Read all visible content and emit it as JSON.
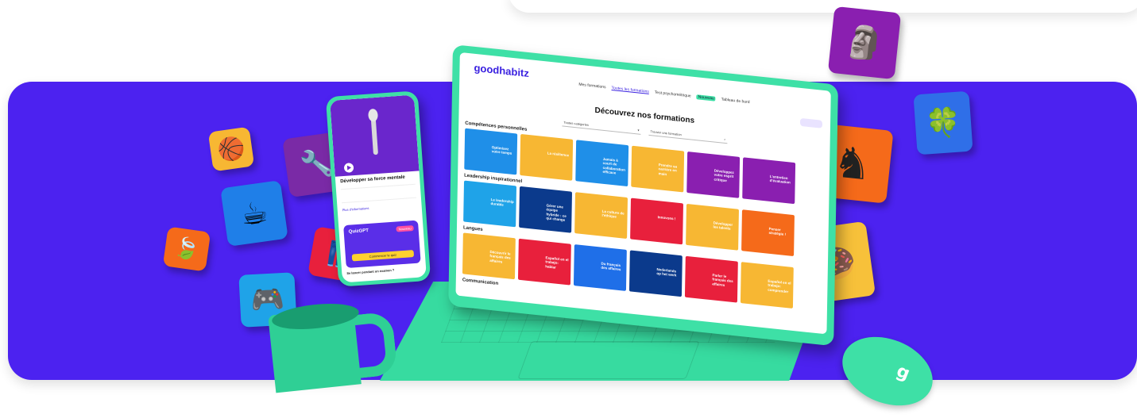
{
  "laptop": {
    "brand": "goodhabitz",
    "nav": {
      "mes_formations": "Mes formations",
      "toutes_formations": "Toutes les formations",
      "test": "Test psychométrique",
      "badge": "Nouveau",
      "tableau": "Tableau de bord"
    },
    "heading": "Découvrez nos formations",
    "filters": {
      "category": "Toutes catégories",
      "search_placeholder": "Trouver une formation"
    },
    "sections": [
      {
        "title": "Compétences personnelles",
        "cards": [
          {
            "text": "Optimisez votre temps",
            "color": "#1f8fe8"
          },
          {
            "text": "La résilience",
            "color": "#f7b733"
          },
          {
            "text": "Jamais à court de collaboration efficace",
            "color": "#1f8fe8"
          },
          {
            "text": "Prendre sa carrière en main",
            "color": "#f7b733"
          },
          {
            "text": "Développez votre esprit critique",
            "color": "#8a1fb0"
          },
          {
            "text": "L'entretien d'évaluation",
            "color": "#8a1fb0"
          }
        ]
      },
      {
        "title": "Leadership inspirationnel",
        "cards": [
          {
            "text": "Le leadership durable",
            "color": "#1fa3e8"
          },
          {
            "text": "Gérer une équipe hybride : ce qui change",
            "color": "#0b3a8c"
          },
          {
            "text": "La culture de l'éthique",
            "color": "#f7b733"
          },
          {
            "text": "Innovons !",
            "color": "#e8203c"
          },
          {
            "text": "Développer les talents",
            "color": "#f7b733"
          },
          {
            "text": "Penser stratégie !",
            "color": "#f56a1a"
          }
        ]
      },
      {
        "title": "Langues",
        "cards": [
          {
            "text": "Découvrir le français des affaires",
            "color": "#f7b733"
          },
          {
            "text": "Español en el trabajo: hablar",
            "color": "#e8203c"
          },
          {
            "text": "Du français des affaires",
            "color": "#1f6fe8"
          },
          {
            "text": "Nederlands op het werk",
            "color": "#0b3a8c"
          },
          {
            "text": "Parler le français des affaires",
            "color": "#e8203c"
          },
          {
            "text": "Español en el trabajo: comprender",
            "color": "#f7b733"
          }
        ]
      },
      {
        "title": "Communication",
        "cards": []
      }
    ]
  },
  "phone": {
    "title": "Développer sa force mentale",
    "link": "Plus d'informations",
    "quiz_title": "QuizGPT",
    "quiz_tag": "Nouveau",
    "quiz_button": "Commencer le quiz",
    "footer": "Se lancer pendant un examen ?"
  },
  "mouse_logo": "g",
  "colors": {
    "banner": "#4c22f0",
    "device_green": "#3ee0a6",
    "brand_purple": "#3a21e0",
    "quiz_yellow": "#ffd12e"
  },
  "icons": [
    "basketball-tile",
    "coffee-tile",
    "leaf-tile",
    "gamepad-tile",
    "tools-tile",
    "clothes-tile",
    "buddha-tile",
    "clover-tile",
    "chess-knight-tile",
    "donut-tile"
  ]
}
